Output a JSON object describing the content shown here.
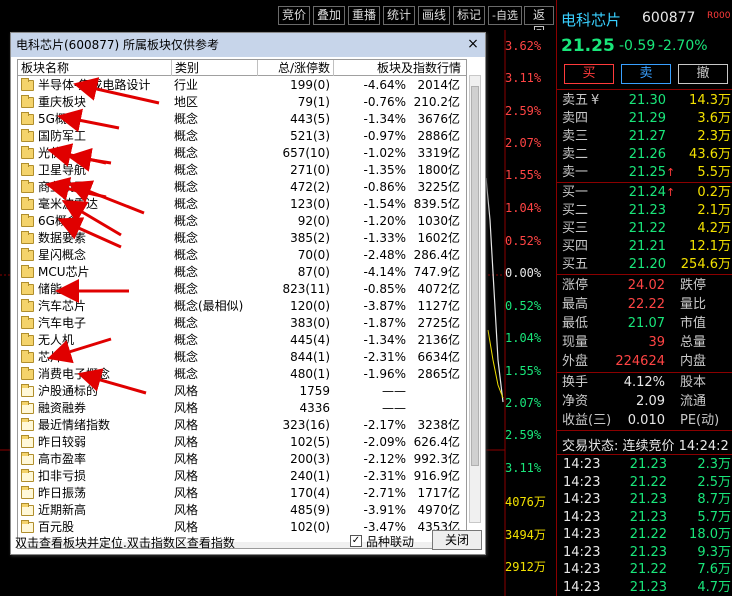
{
  "toolbar": {
    "buttons": [
      "竞价",
      "叠加",
      "重播",
      "统计",
      "画线",
      "标记",
      "-自选",
      "返回"
    ]
  },
  "axis": {
    "red": [
      "3.62%",
      "3.11%",
      "2.59%",
      "2.07%",
      "1.55%",
      "1.04%",
      "0.52%"
    ],
    "zero": "0.00%",
    "green": [
      "0.52%",
      "1.04%",
      "1.55%",
      "2.07%",
      "2.59%",
      "3.11%"
    ],
    "volume": [
      "4076万",
      "3494万",
      "2912万"
    ]
  },
  "quote": {
    "name": "电科芯片",
    "code": "600877",
    "logo": "R000",
    "price": "21.25",
    "change": "-0.59",
    "pct": "-2.70%",
    "buy_label": "买",
    "sell_label": "卖",
    "cancel_label": "撤"
  },
  "asks": [
    {
      "label": "卖五",
      "mark": "¥",
      "price": "21.30",
      "vol": "14.3万",
      "color": "green"
    },
    {
      "label": "卖四",
      "mark": "",
      "price": "21.29",
      "vol": "3.6万",
      "color": "green"
    },
    {
      "label": "卖三",
      "mark": "",
      "price": "21.27",
      "vol": "2.3万",
      "color": "green"
    },
    {
      "label": "卖二",
      "mark": "",
      "price": "21.26",
      "vol": "43.6万",
      "color": "green"
    },
    {
      "label": "卖一",
      "mark": "",
      "price": "21.25",
      "vol": "5.5万",
      "color": "green",
      "up": "↑"
    }
  ],
  "bids": [
    {
      "label": "买一",
      "price": "21.24",
      "vol": "0.2万",
      "up": "↑"
    },
    {
      "label": "买二",
      "price": "21.23",
      "vol": "2.1万"
    },
    {
      "label": "买三",
      "price": "21.22",
      "vol": "4.2万"
    },
    {
      "label": "买四",
      "price": "21.21",
      "vol": "12.1万"
    },
    {
      "label": "买五",
      "price": "21.20",
      "vol": "254.6万"
    }
  ],
  "stats": [
    {
      "l1": "涨停",
      "v1": "24.02",
      "c1": "red",
      "l2": "跌停"
    },
    {
      "l1": "最高",
      "v1": "22.22",
      "c1": "red",
      "l2": "量比"
    },
    {
      "l1": "最低",
      "v1": "21.07",
      "c1": "green",
      "l2": "市值"
    },
    {
      "l1": "现量",
      "v1": "39",
      "c1": "red",
      "l2": "总量"
    },
    {
      "l1": "外盘",
      "v1": "224624",
      "c1": "red",
      "l2": "内盘"
    }
  ],
  "stats2": [
    {
      "l1": "换手",
      "v1": "4.12%",
      "l2": "股本"
    },
    {
      "l1": "净资",
      "v1": "2.09",
      "l2": "流通"
    },
    {
      "l1": "收益(三)",
      "v1": "0.010",
      "l2": "PE(动)"
    }
  ],
  "status": "交易状态: 连续竞价 14:24:2",
  "ticks": [
    {
      "t": "14:23",
      "p": "21.23",
      "v": "2.3万"
    },
    {
      "t": "14:23",
      "p": "21.22",
      "v": "2.5万"
    },
    {
      "t": "14:23",
      "p": "21.23",
      "v": "8.7万"
    },
    {
      "t": "14:23",
      "p": "21.23",
      "v": "5.7万"
    },
    {
      "t": "14:23",
      "p": "21.22",
      "v": "18.0万"
    },
    {
      "t": "14:23",
      "p": "21.23",
      "v": "9.3万"
    },
    {
      "t": "14:23",
      "p": "21.22",
      "v": "7.6万"
    },
    {
      "t": "14:23",
      "p": "21.23",
      "v": "4.7万"
    }
  ],
  "dialog": {
    "title": "电科芯片(600877)   所属板块仅供参考",
    "close": "×",
    "headers": [
      "板块名称",
      "类别",
      "总/涨停数",
      "板块及指数行情"
    ],
    "rows": [
      {
        "name": "半导体-集成电路设计",
        "type": "行业",
        "count": "199(0)",
        "pct": "-4.64%",
        "amt": "2014亿"
      },
      {
        "name": "重庆板块",
        "type": "地区",
        "count": "79(1)",
        "pct": "-0.76%",
        "amt": "210.2亿"
      },
      {
        "name": "5G概念",
        "type": "概念",
        "count": "443(5)",
        "pct": "-1.34%",
        "amt": "3676亿"
      },
      {
        "name": "国防军工",
        "type": "概念",
        "count": "521(3)",
        "pct": "-0.97%",
        "amt": "2886亿"
      },
      {
        "name": "光伏",
        "type": "概念",
        "count": "657(10)",
        "pct": "-1.02%",
        "amt": "3319亿"
      },
      {
        "name": "卫星导航",
        "type": "概念",
        "count": "271(0)",
        "pct": "-1.35%",
        "amt": "1800亿"
      },
      {
        "name": "商业航天",
        "type": "概念",
        "count": "472(2)",
        "pct": "-0.86%",
        "amt": "3225亿"
      },
      {
        "name": "毫米波雷达",
        "type": "概念",
        "count": "123(0)",
        "pct": "-1.54%",
        "amt": "839.5亿"
      },
      {
        "name": "6G概念",
        "type": "概念",
        "count": "92(0)",
        "pct": "-1.20%",
        "amt": "1030亿"
      },
      {
        "name": "数据要素",
        "type": "概念",
        "count": "385(2)",
        "pct": "-1.33%",
        "amt": "1602亿"
      },
      {
        "name": "星闪概念",
        "type": "概念",
        "count": "70(0)",
        "pct": "-2.48%",
        "amt": "286.4亿"
      },
      {
        "name": "MCU芯片",
        "type": "概念",
        "count": "87(0)",
        "pct": "-4.14%",
        "amt": "747.9亿"
      },
      {
        "name": "储能",
        "type": "概念",
        "count": "823(11)",
        "pct": "-0.85%",
        "amt": "4072亿"
      },
      {
        "name": "汽车芯片",
        "type": "概念(最相似)",
        "count": "120(0)",
        "pct": "-3.87%",
        "amt": "1127亿"
      },
      {
        "name": "汽车电子",
        "type": "概念",
        "count": "383(0)",
        "pct": "-1.87%",
        "amt": "2725亿"
      },
      {
        "name": "无人机",
        "type": "概念",
        "count": "445(4)",
        "pct": "-1.34%",
        "amt": "2136亿"
      },
      {
        "name": "芯片",
        "type": "概念",
        "count": "844(1)",
        "pct": "-2.31%",
        "amt": "6634亿"
      },
      {
        "name": "消费电子概念",
        "type": "概念",
        "count": "480(1)",
        "pct": "-1.96%",
        "amt": "2865亿"
      },
      {
        "name": "沪股通标的",
        "type": "风格",
        "count": "1759",
        "pct": "——",
        "amt": ""
      },
      {
        "name": "融资融券",
        "type": "风格",
        "count": "4336",
        "pct": "——",
        "amt": ""
      },
      {
        "name": "最近情绪指数",
        "type": "风格",
        "count": "323(16)",
        "pct": "-2.17%",
        "amt": "3238亿"
      },
      {
        "name": "昨日较弱",
        "type": "风格",
        "count": "102(5)",
        "pct": "-2.09%",
        "amt": "626.4亿"
      },
      {
        "name": "高市盈率",
        "type": "风格",
        "count": "200(3)",
        "pct": "-2.12%",
        "amt": "992.3亿"
      },
      {
        "name": "扣非亏损",
        "type": "风格",
        "count": "240(1)",
        "pct": "-2.31%",
        "amt": "916.9亿"
      },
      {
        "name": "昨日振荡",
        "type": "风格",
        "count": "170(4)",
        "pct": "-2.71%",
        "amt": "1717亿"
      },
      {
        "name": "近期新高",
        "type": "风格",
        "count": "485(9)",
        "pct": "-3.91%",
        "amt": "4970亿"
      },
      {
        "name": "百元股",
        "type": "风格",
        "count": "102(0)",
        "pct": "-3.47%",
        "amt": "4353亿"
      }
    ],
    "footer": "双击查看板块并定位.双击指数区查看指数",
    "linkage_label": "品种联动",
    "linkage_checked": "✓",
    "close_button": "关闭"
  }
}
